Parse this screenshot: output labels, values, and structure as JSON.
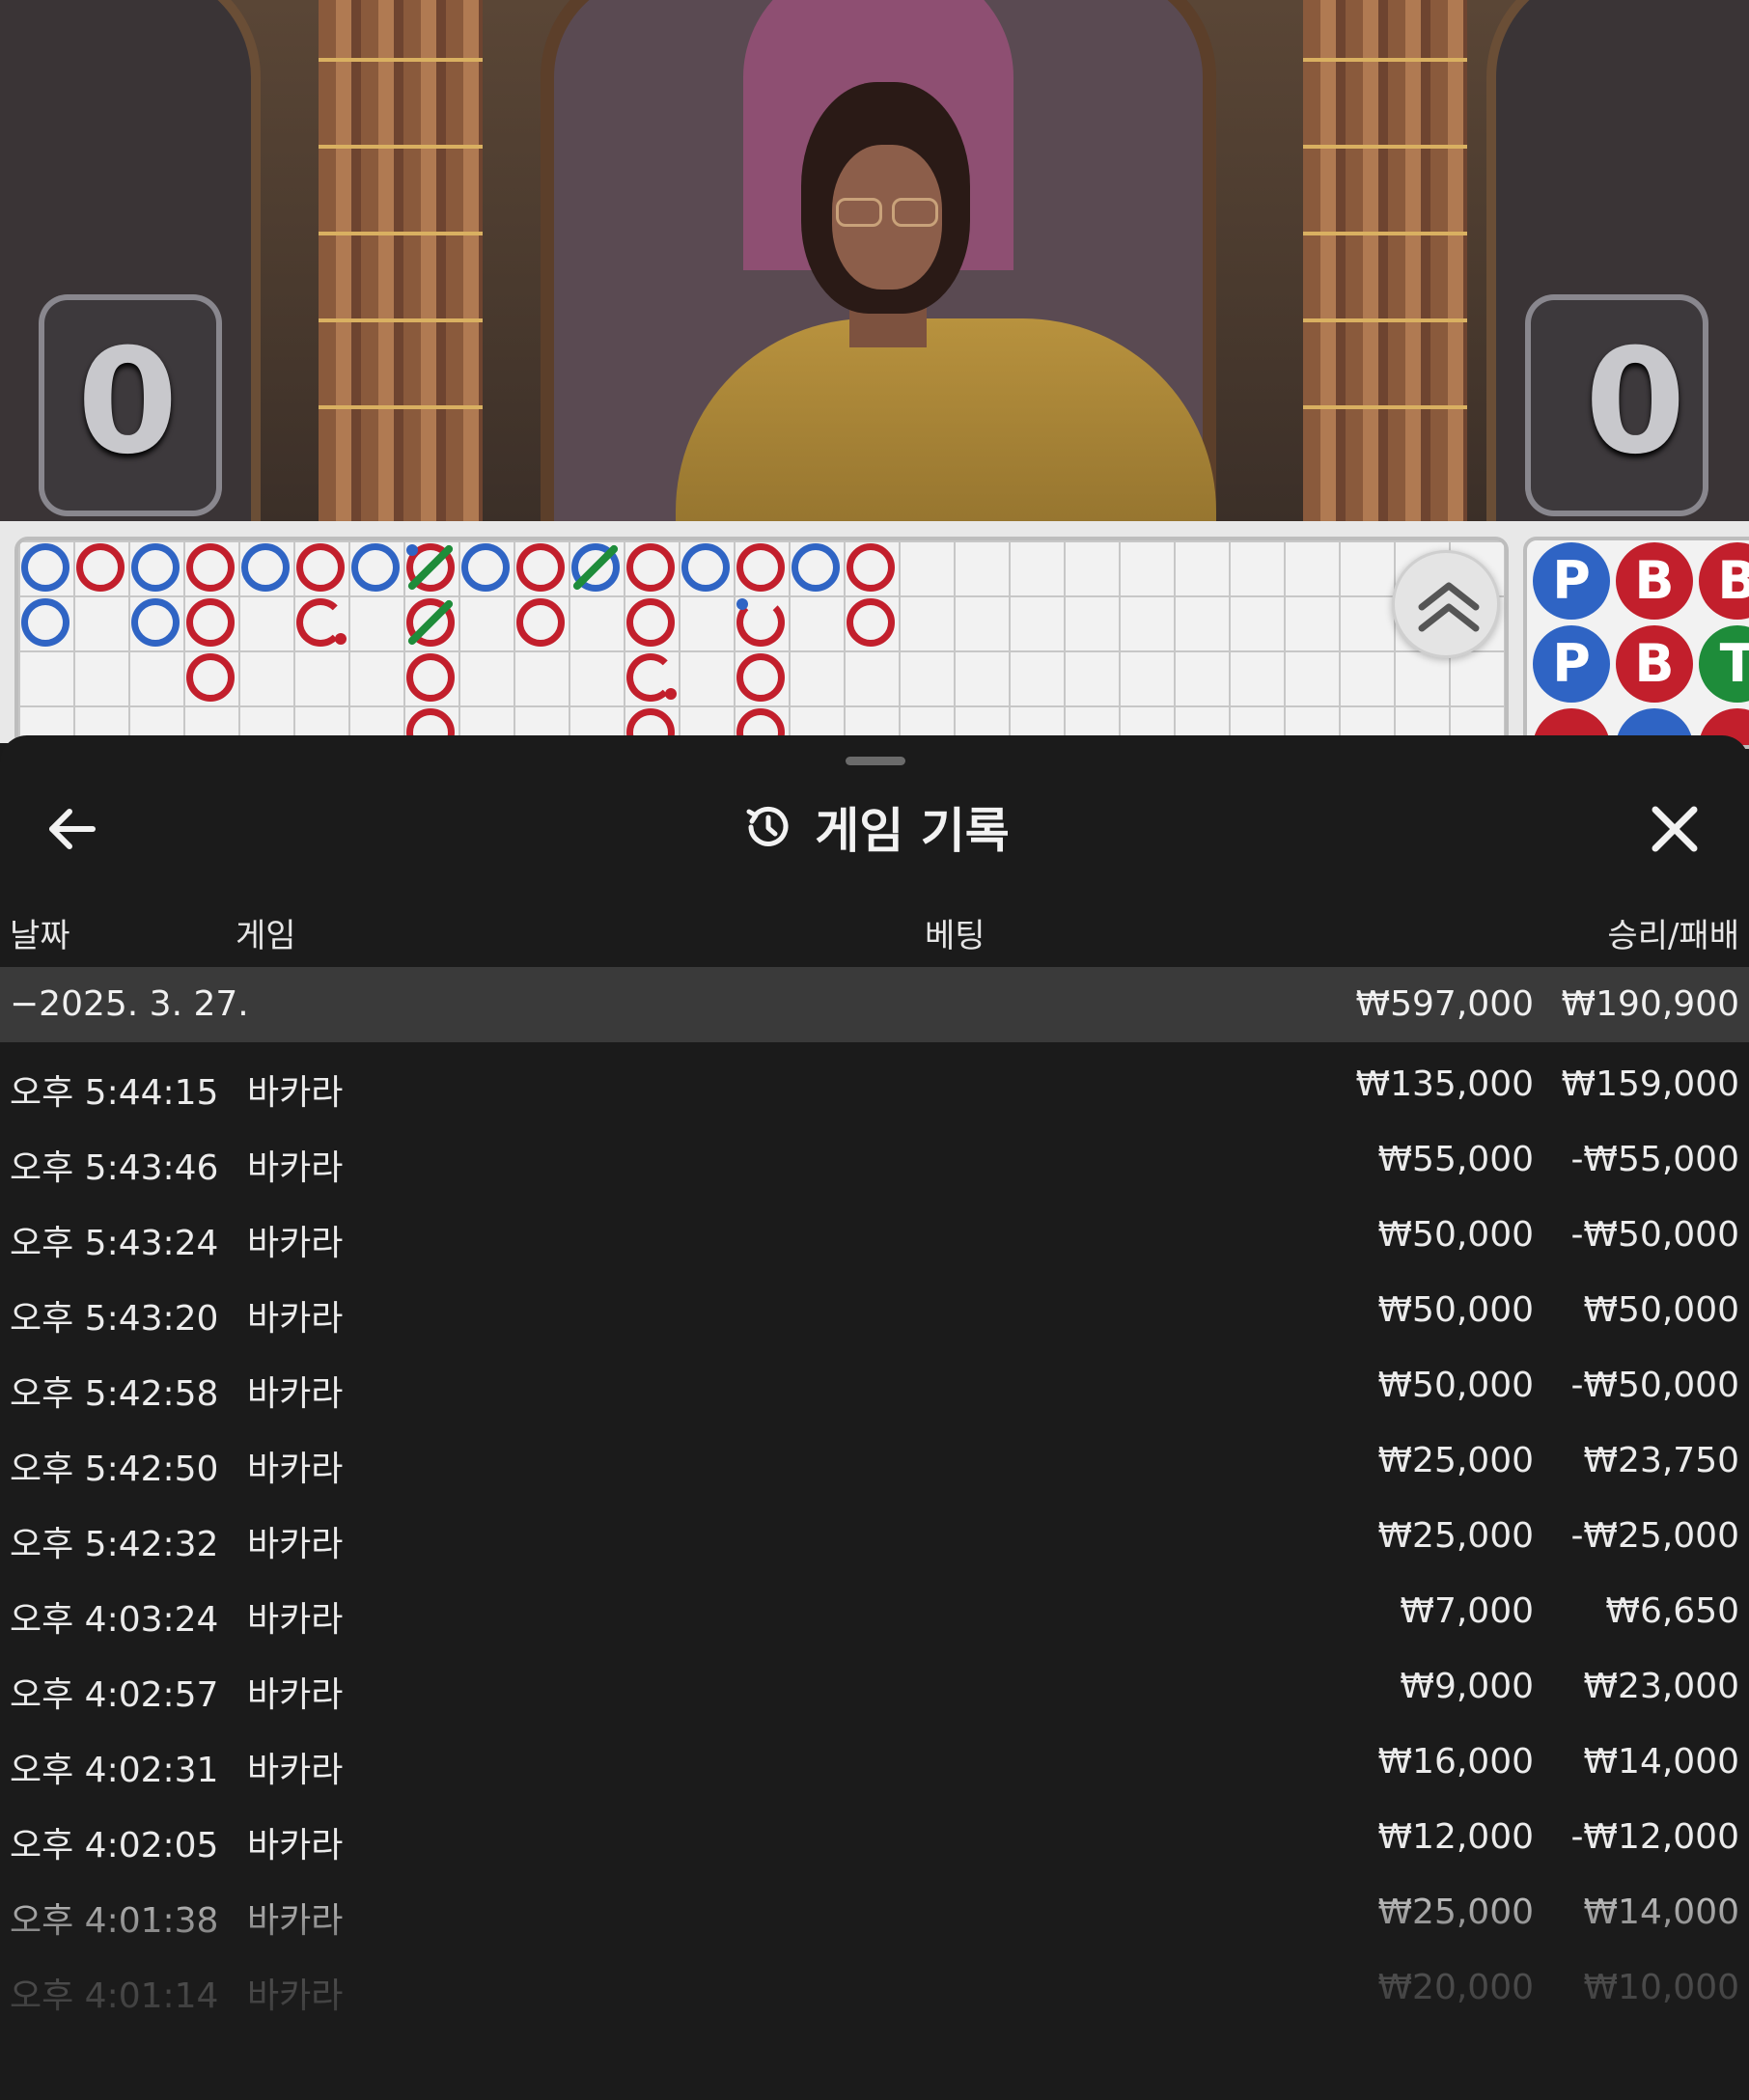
{
  "video": {
    "player_score": "0",
    "banker_score": "0"
  },
  "roadmap": {
    "collapse_icon": "chevron-double-up-icon",
    "bead_road": [
      {
        "label": "P",
        "color": "#2f64c4"
      },
      {
        "label": "B",
        "color": "#c21f2c"
      },
      {
        "label": "B",
        "color": "#c21f2c"
      },
      {
        "label": "P",
        "color": "#2f64c4"
      },
      {
        "label": "B",
        "color": "#c21f2c"
      },
      {
        "label": "T",
        "color": "#1e8c3a"
      }
    ]
  },
  "sheet": {
    "title": "게임 기록",
    "back_icon": "arrow-left-icon",
    "close_icon": "close-icon",
    "history_icon": "history-clock-icon",
    "columns": {
      "date": "날짜",
      "game": "게임",
      "bet": "베팅",
      "win_loss": "승리/패배"
    },
    "date_group": {
      "date": "−2025. 3. 27.",
      "bet_total": "₩597,000",
      "win_total": "₩190,900"
    },
    "rows": [
      {
        "time": "오후 5:44:15",
        "game": "바카라",
        "bet": "₩135,000",
        "result": "₩159,000"
      },
      {
        "time": "오후 5:43:46",
        "game": "바카라",
        "bet": "₩55,000",
        "result": "-₩55,000"
      },
      {
        "time": "오후 5:43:24",
        "game": "바카라",
        "bet": "₩50,000",
        "result": "-₩50,000"
      },
      {
        "time": "오후 5:43:20",
        "game": "바카라",
        "bet": "₩50,000",
        "result": "₩50,000"
      },
      {
        "time": "오후 5:42:58",
        "game": "바카라",
        "bet": "₩50,000",
        "result": "-₩50,000"
      },
      {
        "time": "오후 5:42:50",
        "game": "바카라",
        "bet": "₩25,000",
        "result": "₩23,750"
      },
      {
        "time": "오후 5:42:32",
        "game": "바카라",
        "bet": "₩25,000",
        "result": "-₩25,000"
      },
      {
        "time": "오후 4:03:24",
        "game": "바카라",
        "bet": "₩7,000",
        "result": "₩6,650"
      },
      {
        "time": "오후 4:02:57",
        "game": "바카라",
        "bet": "₩9,000",
        "result": "₩23,000"
      },
      {
        "time": "오후 4:02:31",
        "game": "바카라",
        "bet": "₩16,000",
        "result": "₩14,000"
      },
      {
        "time": "오후 4:02:05",
        "game": "바카라",
        "bet": "₩12,000",
        "result": "-₩12,000"
      },
      {
        "time": "오후 4:01:38",
        "game": "바카라",
        "bet": "₩25,000",
        "result": "₩14,000"
      },
      {
        "time": "오후 4:01:14",
        "game": "바카라",
        "bet": "₩20,000",
        "result": "₩10,000"
      }
    ]
  }
}
